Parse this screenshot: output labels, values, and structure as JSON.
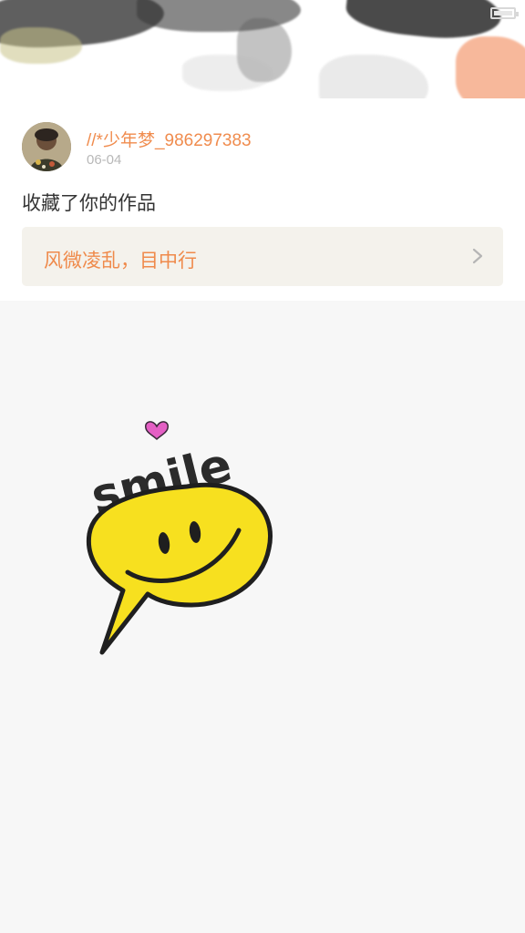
{
  "notification": {
    "username": "//*少年梦_986297383",
    "date": "06-04",
    "action": "收藏了你的作品",
    "work_title": "风微凌乱，目中行"
  },
  "sticker": {
    "text": "smile"
  },
  "colors": {
    "accent": "#f08c4e",
    "card_bg": "#ffffff",
    "page_bg": "#f7f7f7",
    "link_bg": "#f4f2ec",
    "smiley_yellow": "#f7e01f"
  }
}
